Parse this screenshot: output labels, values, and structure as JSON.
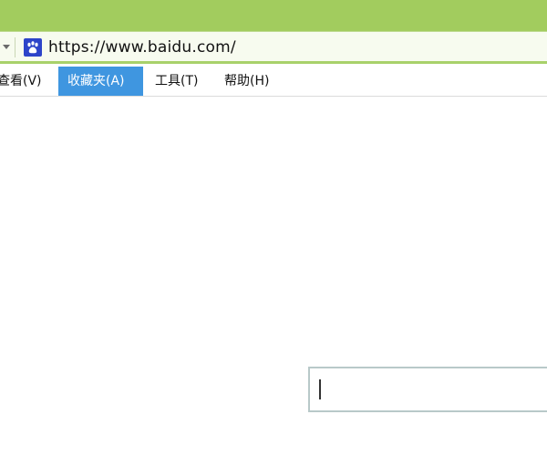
{
  "address_bar": {
    "url": "https://www.baidu.com/",
    "site_icon": "baidu-paw-icon",
    "dropdown_icon": "chevron-down-icon"
  },
  "menu": {
    "items": [
      {
        "label": "查看(V)"
      },
      {
        "label": "收藏夹(A)",
        "selected": true
      },
      {
        "label": "工具(T)"
      },
      {
        "label": "帮助(H)"
      }
    ]
  },
  "search": {
    "value": ""
  },
  "colors": {
    "titlebar": "#a2cc5e",
    "address_border": "#a8d16a",
    "menu_selected": "#3f96e0",
    "site_icon": "#2d44c9"
  }
}
